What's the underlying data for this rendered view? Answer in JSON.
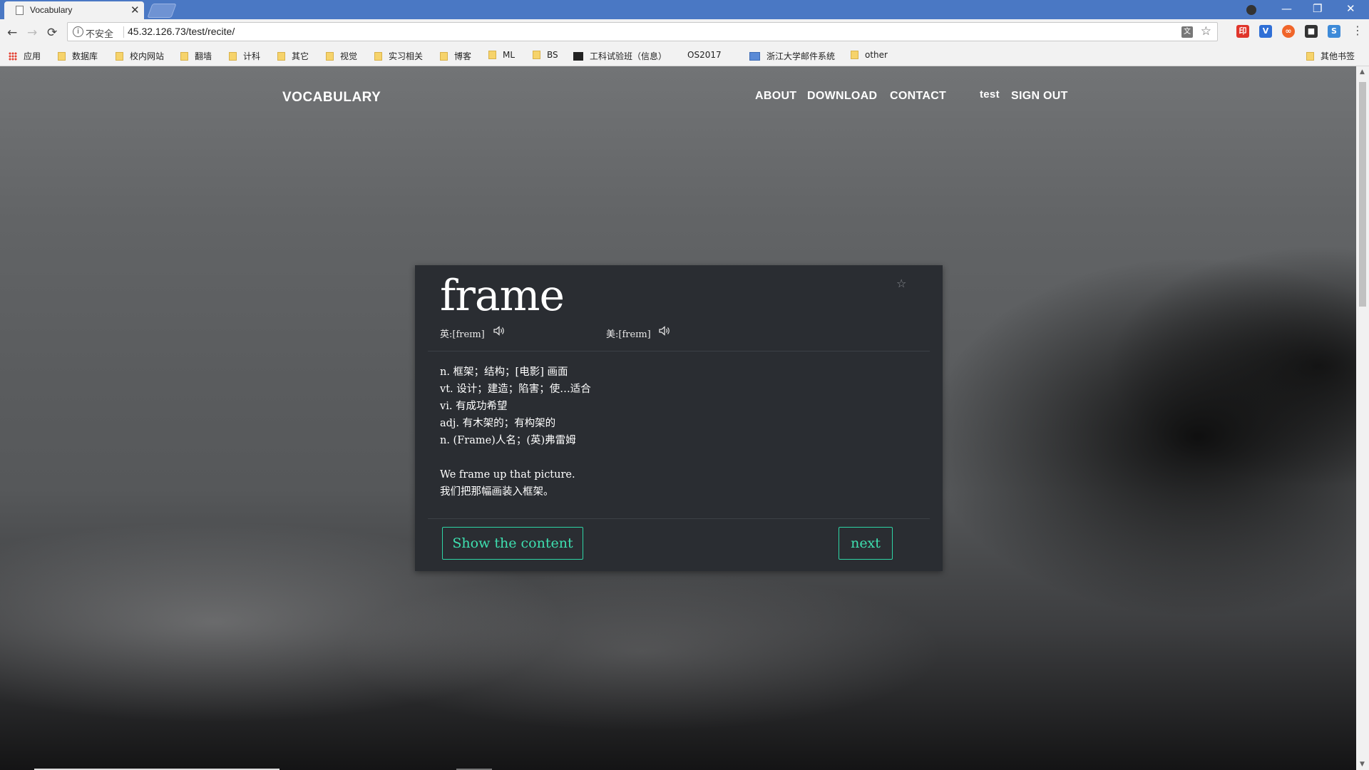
{
  "browser": {
    "tab": {
      "title": "Vocabulary",
      "close": "✕"
    },
    "window_controls": {
      "minimize": "—",
      "maximize": "❐",
      "close": "✕"
    },
    "nav": {
      "back": "←",
      "forward": "→",
      "reload": "⟳"
    },
    "address": {
      "security_label": "不安全",
      "url": "45.32.126.73/test/recite/",
      "info": "i"
    },
    "star": "☆",
    "menu": "⋮",
    "extensions": [
      {
        "name": "extension-red-icon",
        "label": "印",
        "color": "#e0352b"
      },
      {
        "name": "extension-v-icon",
        "label": "V",
        "color": "#2f6fd6"
      },
      {
        "name": "extension-orange-icon",
        "label": "∞",
        "color": "#f0652a"
      },
      {
        "name": "extension-dark-icon",
        "label": "■",
        "color": "#333333"
      },
      {
        "name": "extension-blue-icon",
        "label": "S",
        "color": "#3d8ad8"
      }
    ],
    "bookmarks": [
      {
        "label": "应用",
        "icon": "apps"
      },
      {
        "label": "数据库",
        "icon": "folder"
      },
      {
        "label": "校内网站",
        "icon": "folder"
      },
      {
        "label": "翻墙",
        "icon": "folder"
      },
      {
        "label": "计科",
        "icon": "folder"
      },
      {
        "label": "其它",
        "icon": "folder"
      },
      {
        "label": "视觉",
        "icon": "folder"
      },
      {
        "label": "实习相关",
        "icon": "folder"
      },
      {
        "label": "博客",
        "icon": "folder"
      },
      {
        "label": "ML",
        "icon": "folder"
      },
      {
        "label": "BS",
        "icon": "folder"
      },
      {
        "label": "工科试验班（信息）",
        "icon": "bb"
      },
      {
        "label": "OS2017",
        "icon": "page"
      },
      {
        "label": "浙江大学邮件系统",
        "icon": "mail"
      },
      {
        "label": "other",
        "icon": "folder"
      },
      {
        "label": "其他书签",
        "icon": "folder"
      }
    ]
  },
  "site": {
    "brand": "VOCABULARY",
    "nav": {
      "about": "ABOUT",
      "download": "DOWNLOAD",
      "contact": "CONTACT",
      "user": "test",
      "sign_out": "SIGN OUT"
    }
  },
  "card": {
    "word": "frame",
    "favorite_icon": "☆",
    "phonetic_uk": "英:[freɪm]",
    "phonetic_us": "美:[freɪm]",
    "definitions": [
      "n. 框架；结构；[电影] 画面",
      "vt. 设计；建造；陷害；使…适合",
      "vi. 有成功希望",
      "adj. 有木架的；有构架的",
      "n. (Frame)人名；(英)弗雷姆"
    ],
    "example_en": "We frame up that picture.",
    "example_zh": "我们把那幅画装入框架。",
    "show_button": "Show the content",
    "next_button": "next"
  }
}
